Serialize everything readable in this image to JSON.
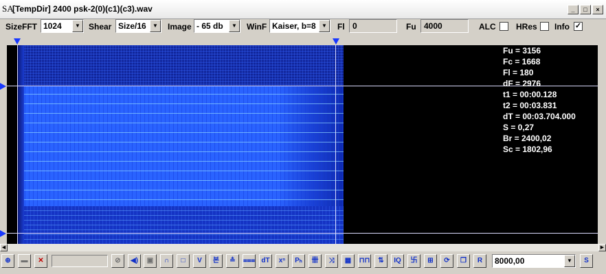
{
  "window": {
    "app_icon": "SA",
    "title": "[TempDir] 2400 psk-2(0)(c1)(c3).wav",
    "buttons": {
      "minimize": "_",
      "maximize": "□",
      "close": "×"
    }
  },
  "toolbar": {
    "sizefft_label": "SizeFFT",
    "sizefft_value": "1024",
    "shear_label": "Shear",
    "shear_value": "Size/16",
    "image_label": "Image",
    "image_value": "- 65 db",
    "winf_label": "WinF",
    "winf_value": "Kaiser, b=8",
    "fl_label": "Fl",
    "fl_value": "0",
    "fu_label": "Fu",
    "fu_value": "4000",
    "alc_label": "ALC",
    "alc_checked": false,
    "hres_label": "HRes",
    "hres_checked": false,
    "info_label": "Info",
    "info_checked": true,
    "check_mark": "✓"
  },
  "info_panel": [
    "Fu = 3156",
    "Fc = 1668",
    "Fl = 180",
    "dF = 2976",
    "t1 = 00:00.128",
    "t2 = 00:03.831",
    "dT = 00:03.704.000",
    "S = 0,27",
    "Br = 2400,02",
    "Sc = 1802,96"
  ],
  "colors": {
    "spectrogram_base": "#2a63ff",
    "cursor_line": "#dcdcff",
    "marker": "#1838ff",
    "plot_background": "#000000"
  },
  "bottombar": {
    "buttons": [
      {
        "name": "zoom-icon",
        "glyph": "⊕"
      },
      {
        "name": "folder-icon",
        "glyph": "▬"
      },
      {
        "name": "clear-icon",
        "glyph": "✕"
      },
      {
        "name": "stop-icon",
        "glyph": "⊘"
      },
      {
        "name": "speaker-icon",
        "glyph": "◀)"
      },
      {
        "name": "square-icon",
        "glyph": "▣"
      },
      {
        "name": "arc-icon",
        "glyph": "∩"
      },
      {
        "name": "rect-icon",
        "glyph": "□"
      },
      {
        "name": "valley-icon",
        "glyph": "V"
      },
      {
        "name": "marker-icon",
        "glyph": "본"
      },
      {
        "name": "marker2-icon",
        "glyph": "≛"
      },
      {
        "name": "marker3-icon",
        "glyph": "⩶"
      },
      {
        "name": "dt-icon",
        "glyph": "dT"
      },
      {
        "name": "xn-icon",
        "glyph": "xⁿ"
      },
      {
        "name": "ph-icon",
        "glyph": "Pₕ"
      },
      {
        "name": "bars-icon",
        "glyph": "卌"
      },
      {
        "name": "cross-icon",
        "glyph": "⤨"
      },
      {
        "name": "grid-icon",
        "glyph": "▦"
      },
      {
        "name": "pulse-icon",
        "glyph": "⊓⊓"
      },
      {
        "name": "updown-icon",
        "glyph": "⇅"
      },
      {
        "name": "iq-icon",
        "glyph": "IQ"
      },
      {
        "name": "meander-icon",
        "glyph": "卐"
      },
      {
        "name": "pattern-icon",
        "glyph": "⊞"
      },
      {
        "name": "refresh-icon",
        "glyph": "⟳"
      },
      {
        "name": "copy-icon",
        "glyph": "❐"
      },
      {
        "name": "r-icon",
        "glyph": "R"
      }
    ],
    "rate_value": "8000,00",
    "s_label": "S"
  }
}
